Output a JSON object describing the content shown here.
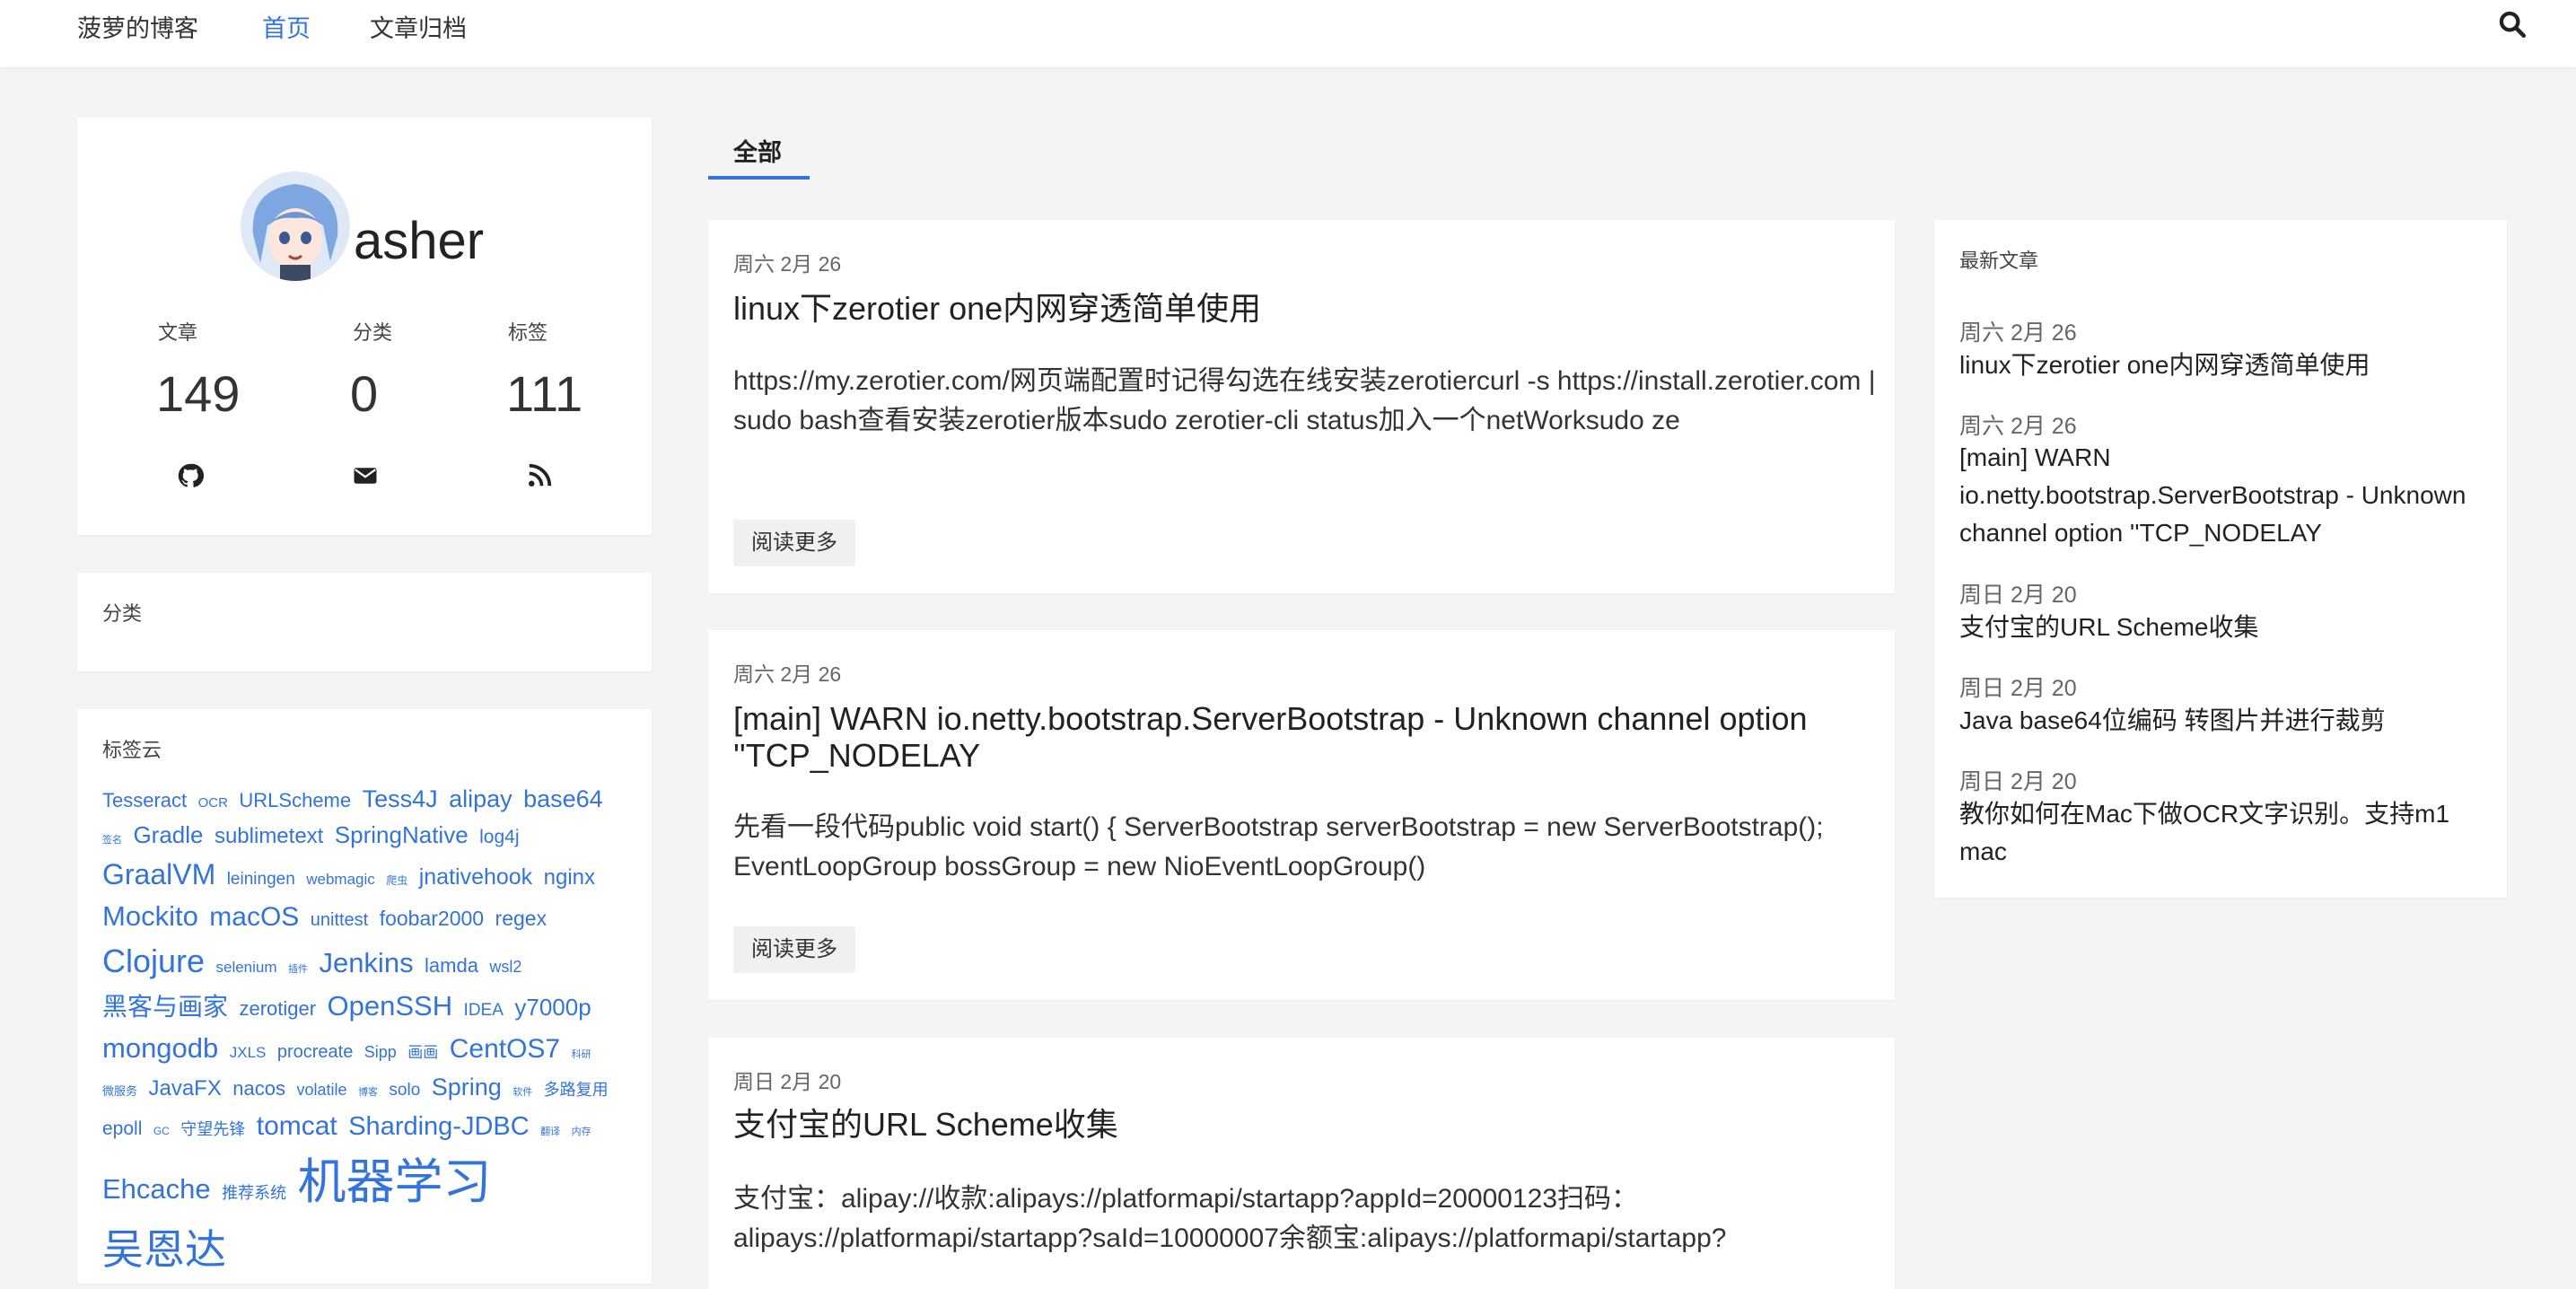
{
  "nav": {
    "brand": "菠萝的博客",
    "home": "首页",
    "archive": "文章归档"
  },
  "profile": {
    "name": "asher",
    "stats": [
      {
        "label": "文章",
        "value": "149"
      },
      {
        "label": "分类",
        "value": "0"
      },
      {
        "label": "标签",
        "value": "111"
      }
    ]
  },
  "categories": {
    "title": "分类"
  },
  "tag_cloud": {
    "title": "标签云",
    "tags": [
      "Tesseract",
      "OCR",
      "URLScheme",
      "Tess4J",
      "alipay",
      "base64",
      "签名",
      "Gradle",
      "sublimetext",
      "SpringNative",
      "log4j",
      "GraalVM",
      "leiningen",
      "webmagic",
      "爬虫",
      "jnativehook",
      "nginx",
      "Mockito",
      "macOS",
      "unittest",
      "foobar2000",
      "regex",
      "Clojure",
      "selenium",
      "插件",
      "Jenkins",
      "lamda",
      "wsl2",
      "黑客与画家",
      "zerotiger",
      "OpenSSH",
      "IDEA",
      "y7000p",
      "mongodb",
      "JXLS",
      "procreate",
      "Sipp",
      "画画",
      "CentOS7",
      "科研",
      "微服务",
      "JavaFX",
      "nacos",
      "volatile",
      "博客",
      "solo",
      "Spring",
      "软件",
      "多路复用",
      "epoll",
      "GC",
      "守望先锋",
      "tomcat",
      "Sharding-JDBC",
      "翻译",
      "内存",
      "Ehcache",
      "推荐系统",
      "机器学习",
      "吴恩达"
    ]
  },
  "main": {
    "tab": "全部",
    "posts": [
      {
        "date": "周六 2月 26",
        "title": "linux下zerotier one内网穿透简单使用",
        "excerpt": "https://my.zerotier.com/网页端配置时记得勾选在线安装zerotiercurl -s https://install.zerotier.com | sudo bash查看安装zerotier版本sudo zerotier-cli status加入一个netWorksudo ze",
        "more": "阅读更多"
      },
      {
        "date": "周六 2月 26",
        "title": "[main] WARN io.netty.bootstrap.ServerBootstrap - Unknown channel option ''TCP_NODELAY",
        "excerpt": "先看一段代码public void start() { ServerBootstrap serverBootstrap = new ServerBootstrap(); EventLoopGroup bossGroup = new NioEventLoopGroup()",
        "more": "阅读更多"
      },
      {
        "date": "周日 2月 20",
        "title": "支付宝的URL Scheme收集",
        "excerpt": "支付宝：alipay://收款:alipays://platformapi/startapp?appId=20000123扫码：alipays://platformapi/startapp?saId=10000007余额宝:alipays://platformapi/startapp?",
        "more": "阅读更多"
      }
    ]
  },
  "recent": {
    "title": "最新文章",
    "items": [
      {
        "date": "周六 2月 26",
        "title": "linux下zerotier one内网穿透简单使用"
      },
      {
        "date": "周六 2月 26",
        "title": "[main] WARN io.netty.bootstrap.ServerBootstrap - Unknown channel option ''TCP_NODELAY"
      },
      {
        "date": "周日 2月 20",
        "title": "支付宝的URL Scheme收集"
      },
      {
        "date": "周日 2月 20",
        "title": "Java base64位编码 转图片并进行裁剪"
      },
      {
        "date": "周日 2月 20",
        "title": "教你如何在Mac下做OCR文字识别。支持m1 mac"
      }
    ]
  }
}
